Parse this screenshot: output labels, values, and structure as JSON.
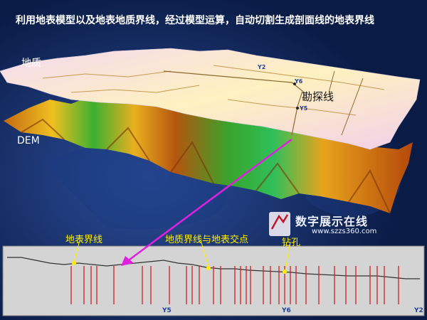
{
  "title": "利用地表模型以及地表地质界线，经过模型运算，自动切割生成剖面线的地表界线",
  "scene": {
    "geology_label": "地质",
    "dem_label": "DEM",
    "survey_line_label": "勘探线",
    "markers": {
      "y2": "Y2",
      "y5": "Y5",
      "y6": "Y6"
    }
  },
  "profile": {
    "surface_line_label": "地表界线",
    "intersection_label": "地质界线与地表交点",
    "drill_label": "钻孔",
    "axis_labels": {
      "y5": "Y5",
      "y6": "Y6",
      "y2": "Y2"
    }
  },
  "watermark": {
    "name": "数字展示在线",
    "url": "www.szzs360.com"
  },
  "colors": {
    "background": "#0b1f4e",
    "annotation": "#ffee00",
    "arrow": "#e020e0",
    "intersection": "#cc2222"
  }
}
